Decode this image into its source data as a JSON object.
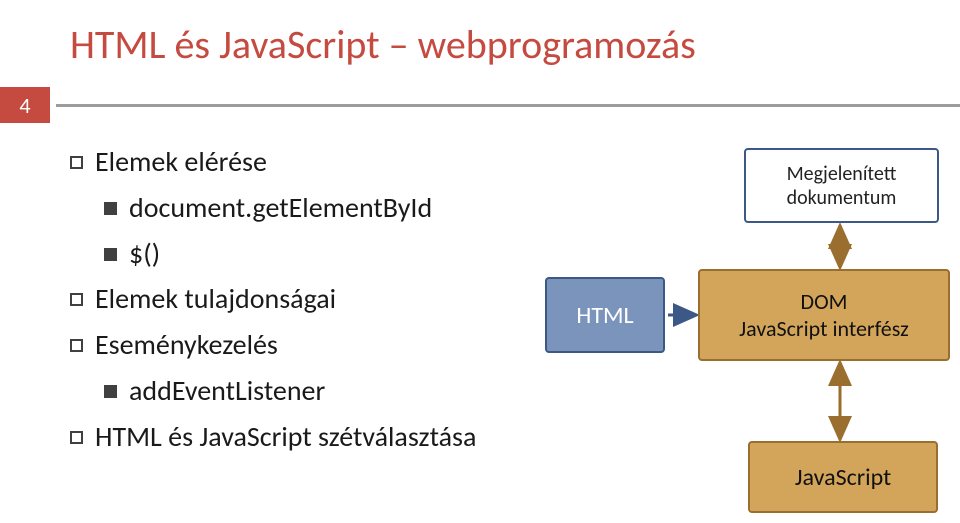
{
  "title": "HTML és JavaScript – webprogramozás",
  "page_number": "4",
  "bullets": {
    "b1": "Elemek elérése",
    "b1a": "document.getElementById",
    "b1b": "$()",
    "b2": "Elemek tulajdonságai",
    "b3": "Eseménykezelés",
    "b3a": "addEventListener",
    "b4": "HTML és JavaScript szétválasztása"
  },
  "diagram": {
    "doc_line1": "Megjelenített",
    "doc_line2": "dokumentum",
    "html": "HTML",
    "dom_line1": "DOM",
    "dom_line2": "JavaScript interfész",
    "js": "JavaScript"
  }
}
